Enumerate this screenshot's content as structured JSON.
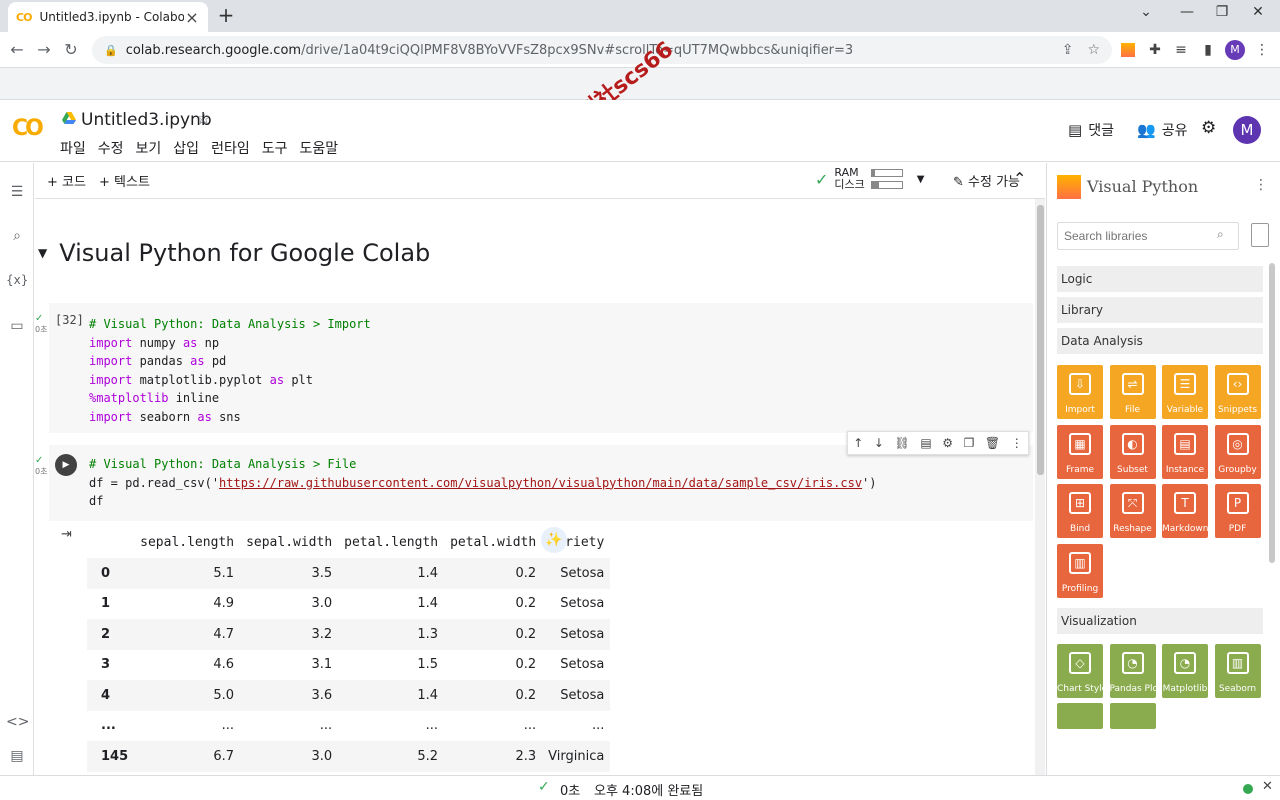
{
  "browser": {
    "tab_title": "Untitled3.ipynb - Colaboratory",
    "tab_favicon": "CO",
    "new_tab": "+",
    "url_host": "colab.research.google.com",
    "url_path": "/drive/1a04t9ciQQlPMF8V8BYoVVFsZ8pcx9SNv#scrollTo=qUT7MQwbbcs&uniqifier=3",
    "profile_initial": "M",
    "window_controls": [
      "⌄",
      "—",
      "❐",
      "✕"
    ]
  },
  "watermark": "数创社scs66",
  "colab": {
    "logo": "CO",
    "notebook_title": "Untitled3.ipynb",
    "menu": [
      "파일",
      "수정",
      "보기",
      "삽입",
      "런타임",
      "도구",
      "도움말"
    ],
    "comment_label": "댓글",
    "share_label": "공유",
    "avatar_initial": "M"
  },
  "toolbar": {
    "add_code": "+ 코드",
    "add_text": "+ 텍스트",
    "ram_label": "RAM",
    "disk_label": "디스크",
    "ram_usage": 0.1,
    "disk_usage": 0.25,
    "edit_label": "수정 가능"
  },
  "notebook": {
    "heading": "Visual Python for Google Colab",
    "cell1": {
      "exec_count": "[32]",
      "status_time": "0초",
      "lines": [
        "# Visual Python: Data Analysis > Import",
        "import numpy as np",
        "import pandas as pd",
        "import matplotlib.pyplot as plt",
        "%matplotlib inline",
        "import seaborn as sns"
      ]
    },
    "cell2": {
      "status_time": "0초",
      "line1": "# Visual Python: Data Analysis > File",
      "line2_pre": "df = pd.read_csv('",
      "line2_url": "https://raw.githubusercontent.com/visualpython/visualpython/main/data/sample_csv/iris.csv",
      "line2_post": "')",
      "line3": "df"
    },
    "table": {
      "columns": [
        "",
        "sepal.length",
        "sepal.width",
        "petal.length",
        "petal.width",
        "variety"
      ],
      "rows": [
        [
          "0",
          "5.1",
          "3.5",
          "1.4",
          "0.2",
          "Setosa"
        ],
        [
          "1",
          "4.9",
          "3.0",
          "1.4",
          "0.2",
          "Setosa"
        ],
        [
          "2",
          "4.7",
          "3.2",
          "1.3",
          "0.2",
          "Setosa"
        ],
        [
          "3",
          "4.6",
          "3.1",
          "1.5",
          "0.2",
          "Setosa"
        ],
        [
          "4",
          "5.0",
          "3.6",
          "1.4",
          "0.2",
          "Setosa"
        ],
        [
          "...",
          "...",
          "...",
          "...",
          "...",
          "..."
        ],
        [
          "145",
          "6.7",
          "3.0",
          "5.2",
          "2.3",
          "Virginica"
        ]
      ]
    }
  },
  "visual_python": {
    "title": "Visual Python",
    "search_placeholder": "Search libraries",
    "sections": [
      "Logic",
      "Library",
      "Data Analysis",
      "Visualization"
    ],
    "data_analysis_tiles": [
      "Import",
      "File",
      "Variable",
      "Snippets",
      "Frame",
      "Subset",
      "Instance",
      "Groupby",
      "Bind",
      "Reshape",
      "Markdown",
      "PDF",
      "Profiling"
    ],
    "visualization_tiles": [
      "Chart Style",
      "Pandas Plot",
      "Matplotlib",
      "Seaborn"
    ]
  },
  "statusbar": {
    "time": "0초",
    "message": "오후 4:08에 완료됨"
  },
  "colors": {
    "colab_orange": "#f9ab00",
    "vp_orange": "#f5a623",
    "vp_dark_orange": "#e8663d",
    "vp_green": "#8bab4f",
    "success_green": "#34a853"
  }
}
